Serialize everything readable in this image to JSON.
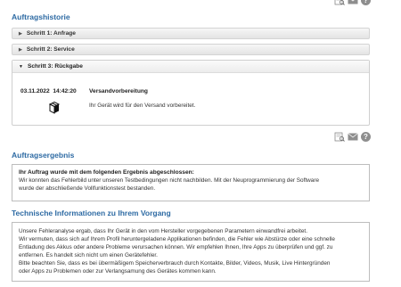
{
  "history": {
    "title": "Auftragshistorie",
    "steps": [
      {
        "label": "Schritt 1: Anfrage"
      },
      {
        "label": "Schritt 2: Service"
      },
      {
        "label": "Schritt 3: Rückgabe"
      }
    ],
    "event": {
      "date": "03.11.2022",
      "time": "14:42:20",
      "title": "Versandvorbereitung",
      "text": "Ihr Gerät wird für den Versand vorbereitet."
    }
  },
  "result": {
    "title": "Auftragsergebnis",
    "heading": "Ihr Auftrag wurde mit dem folgenden Ergebnis abgeschlossen:",
    "line1": "Wir konnten das Fehlerbild unter unseren Testbedingungen nicht nachbilden. Mit der Neuprogrammierung der Software",
    "line2": "wurde der abschließende Vollfunktionstest bestanden."
  },
  "tech": {
    "title": "Technische Informationen zu Ihrem Vorgang",
    "lines": [
      "Unsere Fehleranalyse ergab, dass Ihr Gerät in den vom Hersteller vorgegebenen Parametern einwandfrei arbeitet.",
      "Wir vermuten, dass sich auf Ihrem Profil heruntergeladene Applikationen befinden, die Fehler wie Abstürze oder eine schnelle",
      "Entladung des Akkus oder andere Probleme verursachen können. Wir empfehlen Ihnen, Ihre Apps zu überprüfen und ggf. zu",
      "entfernen. Es handelt sich nicht um einen Gerätefehler.",
      "Bitte beachten Sie, dass es bei übermäßigem Speicherverbrauch durch Kontakte, Bilder, Videos, Musik, Live Hintergründen",
      "oder Apps zu Problemen oder zur Verlangsamung des Gerätes kommen kann."
    ]
  },
  "icons": {
    "print": "print-preview-icon",
    "mail": "mail-icon",
    "help_glyph": "?"
  }
}
